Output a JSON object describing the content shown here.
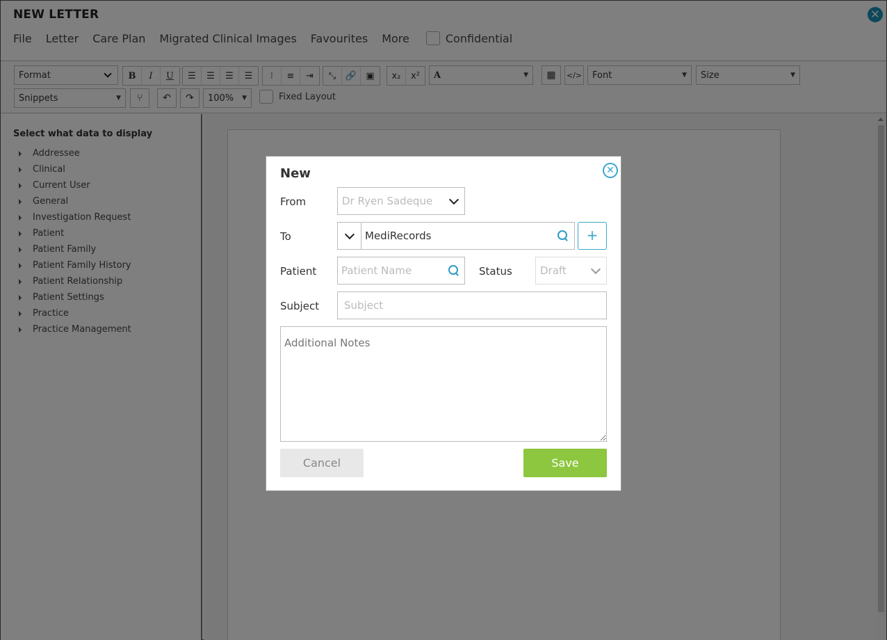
{
  "window": {
    "title": "NEW LETTER"
  },
  "menu": {
    "items": [
      "File",
      "Letter",
      "Care Plan",
      "Migrated Clinical Images",
      "Favourites",
      "More"
    ],
    "confidential_label": "Confidential"
  },
  "toolbar": {
    "format": "Format",
    "font_color_glyph": "A",
    "font": "Font",
    "size": "Size",
    "snippets": "Snippets",
    "zoom": "100%",
    "fixed_layout_label": "Fixed Layout",
    "bold": "B",
    "italic": "I",
    "underline": "U"
  },
  "sidebar": {
    "title": "Select what data to display",
    "items": [
      "Addressee",
      "Clinical",
      "Current User",
      "General",
      "Investigation Request",
      "Patient",
      "Patient Family",
      "Patient Family History",
      "Patient Relationship",
      "Patient Settings",
      "Practice",
      "Practice Management"
    ]
  },
  "dialog": {
    "title": "New",
    "from_label": "From",
    "from_value": "Dr Ryen Sadeque",
    "to_label": "To",
    "to_value": "MediRecords",
    "patient_label": "Patient",
    "patient_placeholder": "Patient Name",
    "status_label": "Status",
    "status_value": "Draft",
    "subject_label": "Subject",
    "subject_placeholder": "Subject",
    "notes_placeholder": "Additional Notes",
    "cancel_label": "Cancel",
    "save_label": "Save",
    "add_symbol": "+"
  },
  "colors": {
    "accent": "#3aa7cc",
    "save_green": "#8dc63f",
    "overlay": "rgba(0,0,0,0.5)"
  }
}
